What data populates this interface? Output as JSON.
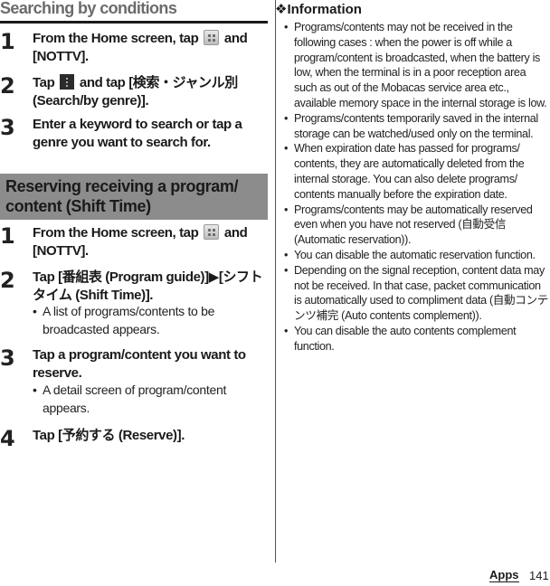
{
  "left": {
    "section1": {
      "title": "Searching by conditions",
      "steps": [
        {
          "num": "1",
          "before_icon": "From the Home screen, tap ",
          "icon": "apps-icon",
          "after_icon": " and [NOTTV]."
        },
        {
          "num": "2",
          "before_icon": "Tap ",
          "icon": "menu-icon",
          "after_icon": " and tap [検索・ジャンル別 (Search/by genre)]."
        },
        {
          "num": "3",
          "text": "Enter a keyword to search or tap a genre you want to search for."
        }
      ]
    },
    "section2": {
      "title": "Reserving receiving a program/ content (Shift Time)",
      "steps": [
        {
          "num": "1",
          "before_icon": "From the Home screen, tap ",
          "icon": "apps-icon",
          "after_icon": " and [NOTTV]."
        },
        {
          "num": "2",
          "text": "Tap [番組表 (Program guide)]▶[シフトタイム (Shift Time)].",
          "sub": "A list of programs/contents to be broadcasted appears."
        },
        {
          "num": "3",
          "text": "Tap a program/content you want to reserve.",
          "sub": "A detail screen of program/content appears."
        },
        {
          "num": "4",
          "text": "Tap [予約する (Reserve)]."
        }
      ]
    }
  },
  "right": {
    "info_title": "❖Information",
    "bullets": [
      "Programs/contents may not be received in the following cases : when the power is off while a program/content is broadcasted, when the battery is low, when the terminal is in a poor reception area such as out of the Mobacas service area etc., available memory space in the internal storage is low.",
      "Programs/contents temporarily saved in the internal storage can be watched/used only on the terminal.",
      "When expiration date has passed for programs/ contents, they are automatically deleted from the internal storage. You can also delete programs/ contents manually before the expiration date.",
      "Programs/contents may be automatically reserved even when you have not reserved (自動受信 (Automatic reservation)).",
      "You can disable the automatic reservation function.",
      "Depending on the signal reception, content data may not be received. In that case, packet communication is automatically used to compliment data (自動コンテンツ補完 (Auto contents complement)).",
      "You can disable the auto contents complement function."
    ],
    "bullet_char": "•"
  },
  "footer": {
    "section": "Apps",
    "page": "141"
  }
}
